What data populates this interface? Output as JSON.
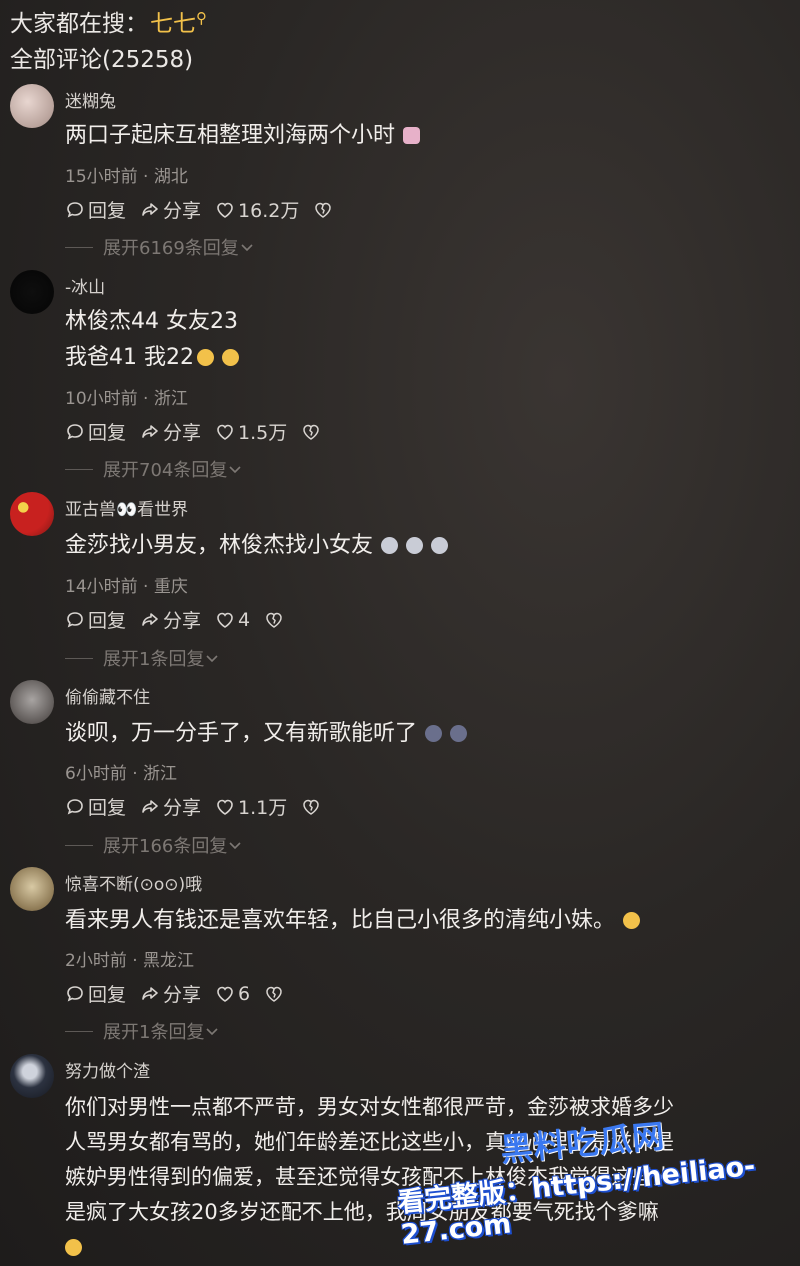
{
  "header": {
    "search_prefix": "大家都在搜：",
    "search_keyword": "七七",
    "comment_count_label": "全部评论(25258)"
  },
  "actions": {
    "reply": "回复",
    "share": "分享"
  },
  "comments": [
    {
      "user": "迷糊兔",
      "lines": [
        "两口子起床互相整理刘海两个小时"
      ],
      "emojis": [
        "couple-emoji"
      ],
      "time": "15小时前",
      "region": "湖北",
      "likes": "16.2万",
      "expand": "展开6169条回复"
    },
    {
      "user": "-冰山",
      "lines": [
        "林俊杰44  女友23",
        "我爸41  我22"
      ],
      "emojis": [
        "smirk-emoji",
        "smirk-emoji"
      ],
      "time": "10小时前",
      "region": "浙江",
      "likes": "1.5万",
      "expand": "展开704条回复"
    },
    {
      "user": "亚古兽👀看世界",
      "lines": [
        "金莎找小男友，林俊杰找小女友"
      ],
      "emojis": [
        "cat-emoji",
        "cat-emoji",
        "cat-emoji"
      ],
      "time": "14小时前",
      "region": "重庆",
      "likes": "4",
      "expand": "展开1条回复"
    },
    {
      "user": "偷偷藏不住",
      "lines": [
        "谈呗，万一分手了，又有新歌能听了"
      ],
      "emojis": [
        "dizzy-emoji",
        "dizzy-emoji"
      ],
      "time": "6小时前",
      "region": "浙江",
      "likes": "1.1万",
      "expand": "展开166条回复"
    },
    {
      "user": "惊喜不断(⊙o⊙)哦",
      "lines": [
        "看来男人有钱还是喜欢年轻，比自己小很多的清纯小妹。"
      ],
      "emojis": [
        "laugh-cry-emoji"
      ],
      "time": "2小时前",
      "region": "黑龙江",
      "likes": "6",
      "expand": "展开1条回复"
    },
    {
      "user": "努力做个渣",
      "lines": [
        "你们对男性一点都不严苛，男女对女性都很严苛，金莎被求婚多少",
        "人骂男女都有骂的，她们年龄差还比这些小，真的心里不是滋味是",
        "嫉妒男性得到的偏爱，甚至还觉得女孩配不上林俊杰我觉得这些人",
        "是疯了大女孩20多岁还配不上他，我周女朋友都要气死找个爹嘛"
      ],
      "emojis": [
        "shock-emoji"
      ]
    }
  ],
  "watermark": {
    "brand": "黑料吃瓜网",
    "text": "看完整版：https://heiliao-27.com"
  },
  "colors": {
    "accent": "#f2c14a",
    "background": "#1f1d1c",
    "watermark": "#3a78f0"
  }
}
